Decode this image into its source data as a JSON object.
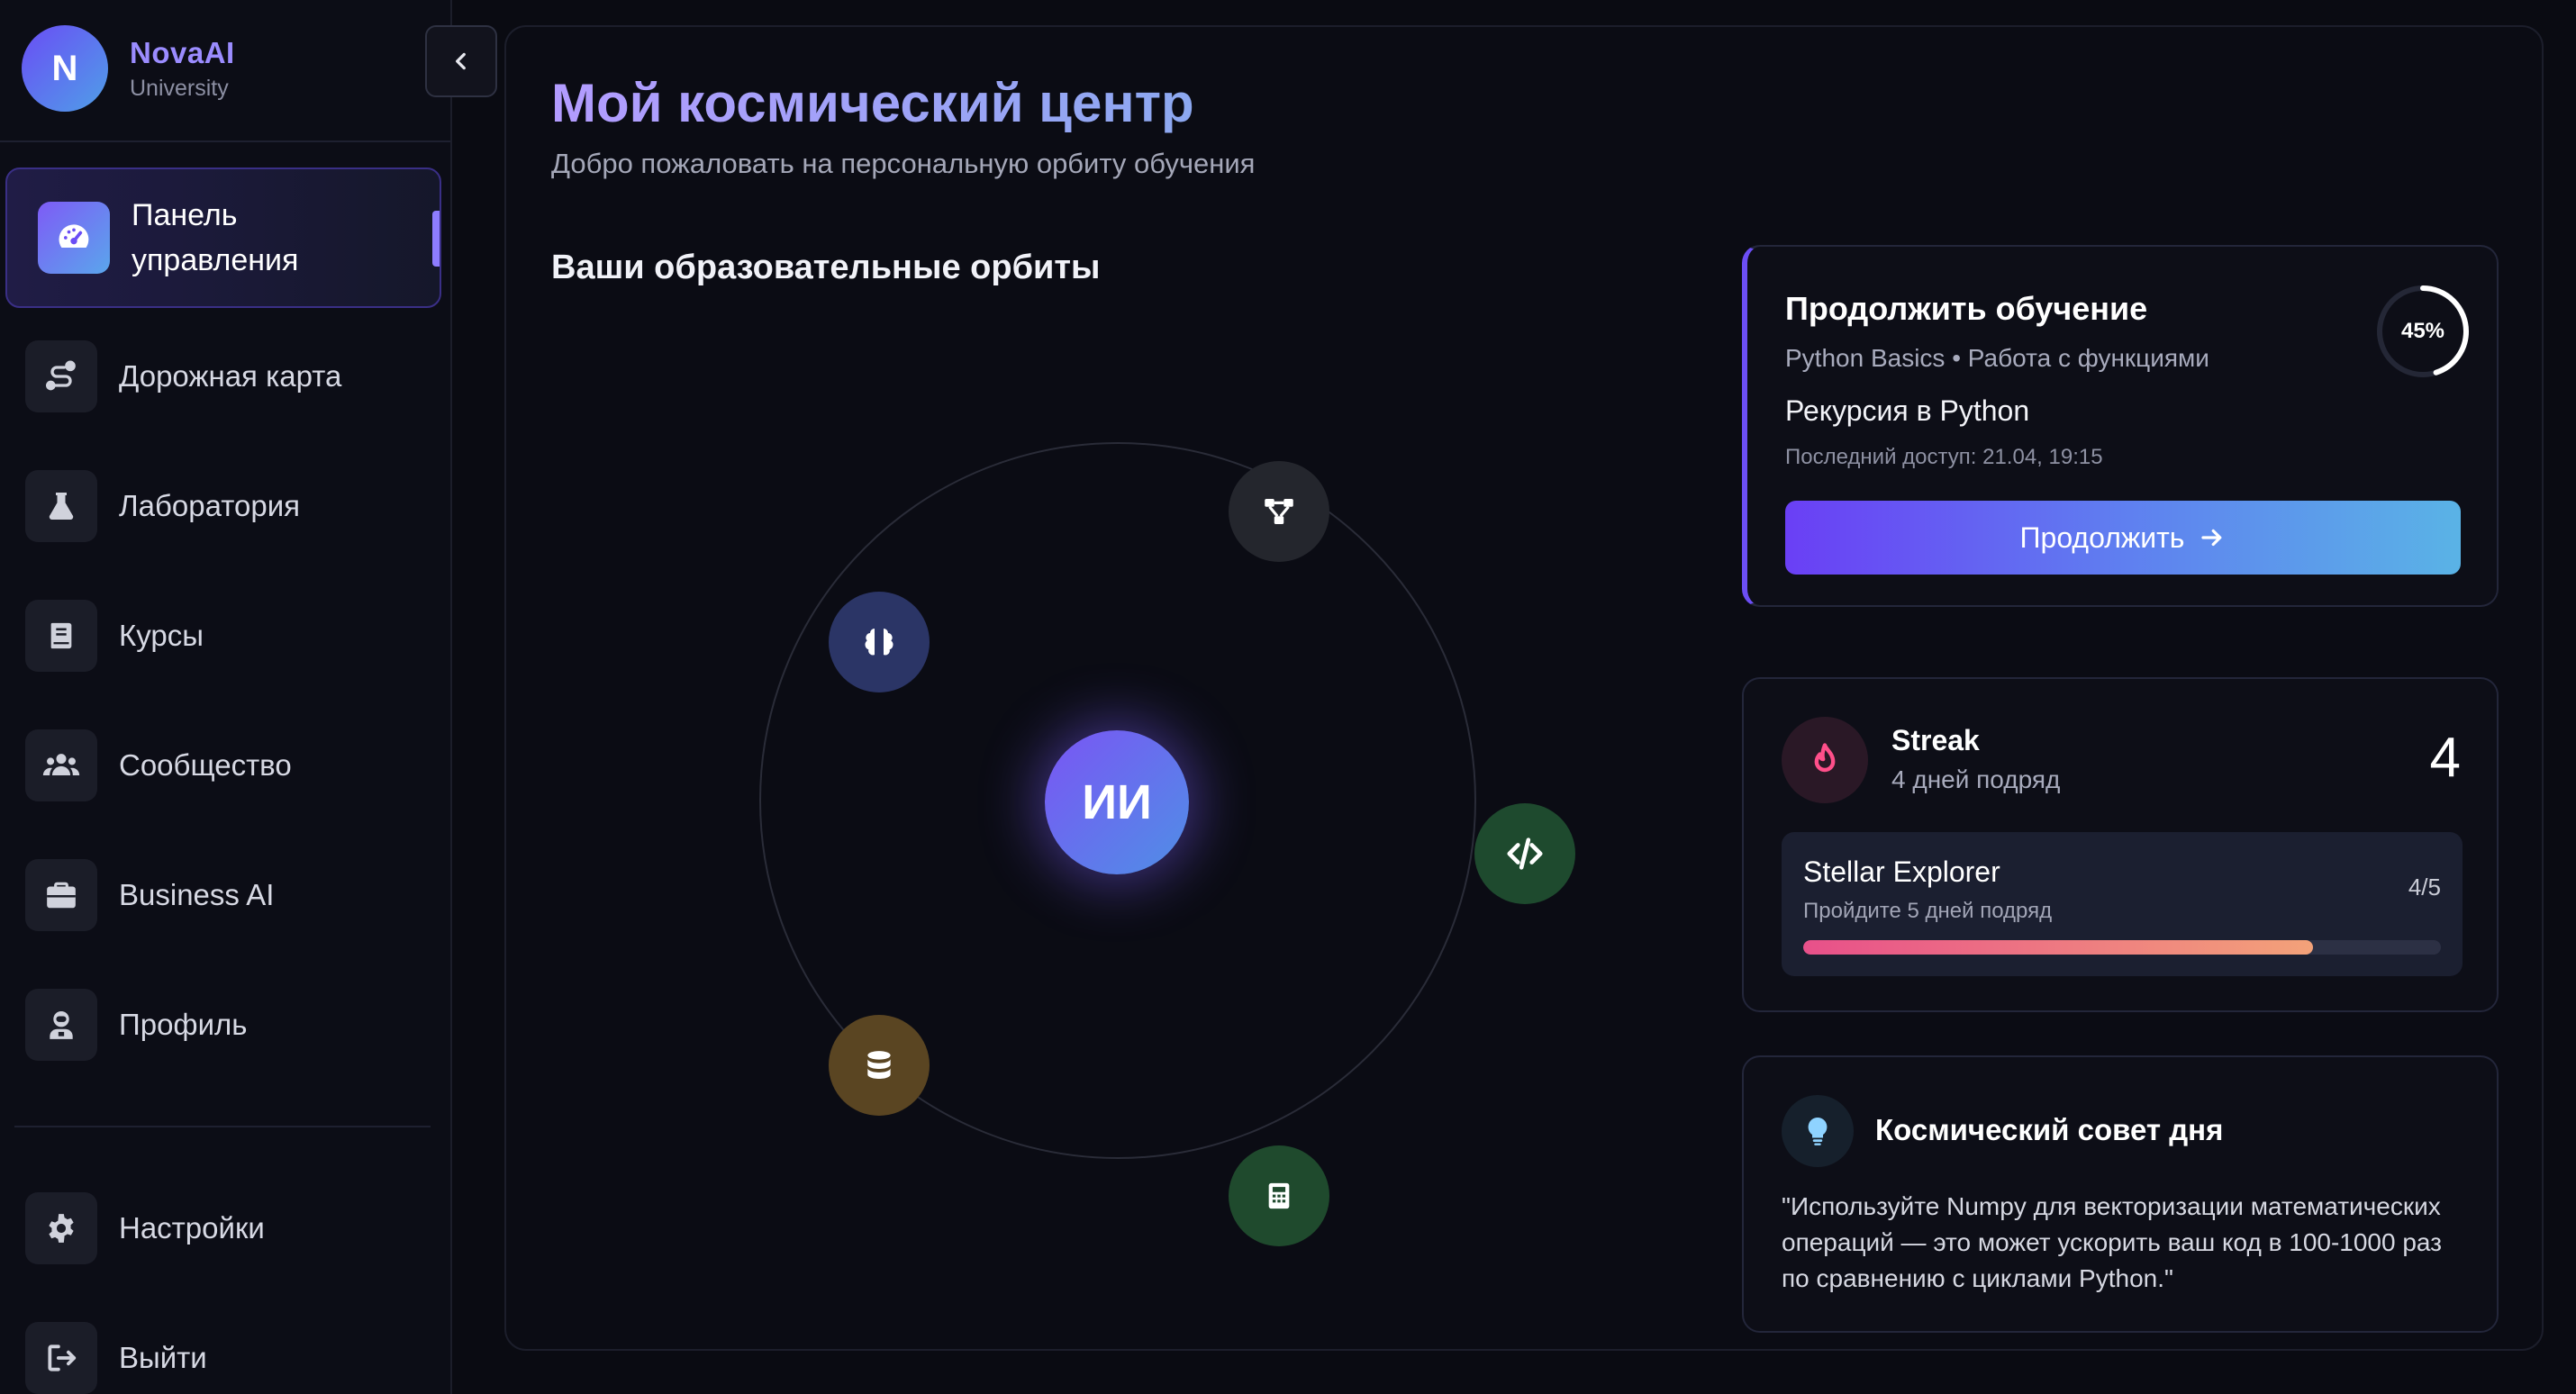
{
  "brand": {
    "initial": "N",
    "name": "NovaAI",
    "subtitle": "University"
  },
  "sidebar": {
    "items": [
      {
        "label": "Панель управления",
        "icon": "gauge-icon",
        "active": true
      },
      {
        "label": "Дорожная карта",
        "icon": "route-icon"
      },
      {
        "label": "Лаборатория",
        "icon": "flask-icon"
      },
      {
        "label": "Курсы",
        "icon": "book-icon"
      },
      {
        "label": "Сообщество",
        "icon": "users-icon"
      },
      {
        "label": "Business AI",
        "icon": "briefcase-icon"
      },
      {
        "label": "Профиль",
        "icon": "user-astronaut-icon"
      }
    ],
    "bottom": [
      {
        "label": "Настройки",
        "icon": "gear-icon"
      },
      {
        "label": "Выйти",
        "icon": "logout-icon"
      }
    ]
  },
  "header": {
    "title": "Мой космический центр",
    "subtitle": "Добро пожаловать на персональную орбиту обучения"
  },
  "orbits": {
    "title": "Ваши образовательные орбиты",
    "core_label": "ИИ",
    "planets": [
      {
        "icon": "brain-icon",
        "color": "#2b3566"
      },
      {
        "icon": "network-icon",
        "color": "#24262d"
      },
      {
        "icon": "code-icon",
        "color": "#1e4a2e"
      },
      {
        "icon": "database-icon",
        "color": "#5a4522"
      },
      {
        "icon": "calculator-icon",
        "color": "#1f4a2d"
      }
    ]
  },
  "continue_card": {
    "title": "Продолжить обучение",
    "course": "Python Basics • Работа с функциями",
    "lesson": "Рекурсия в Python",
    "last_access": "Последний доступ: 21.04, 19:15",
    "progress_label": "45%",
    "progress": 0.45,
    "button_label": "Продолжить"
  },
  "streak_card": {
    "title": "Streak",
    "subtitle": "4 дней подряд",
    "count": "4",
    "achievement": {
      "title": "Stellar Explorer",
      "subtitle": "Пройдите 5 дней подряд",
      "count": "4/5",
      "progress": 0.8
    }
  },
  "tip_card": {
    "title": "Космический совет дня",
    "text": "\"Используйте Numpy для векторизации математических операций — это может ускорить ваш код в 100-1000 раз по сравнению с циклами Python.\""
  },
  "colors": {
    "accent": "#6c4ef5",
    "accent_blue": "#5ab3e6",
    "background": "#0a0b12",
    "streak_pink": "#e8508a"
  }
}
